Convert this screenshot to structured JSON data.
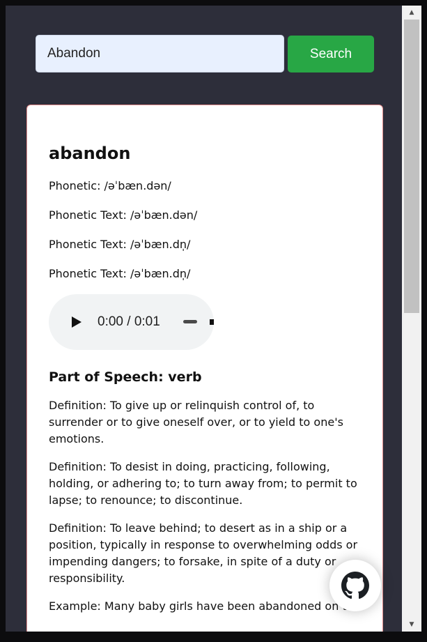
{
  "search": {
    "value": "Abandon",
    "button_label": "Search"
  },
  "entry": {
    "word": "abandon",
    "phonetics": [
      "Phonetic: /əˈbæn.dən/",
      "Phonetic Text: /əˈbæn.dən/",
      "Phonetic Text: /əˈbæn.dn̩/",
      "Phonetic Text: /əˈbæn.dn̩/"
    ],
    "audio": {
      "time": "0:00 / 0:01",
      "progress": 0
    },
    "part_of_speech": "Part of Speech: verb",
    "definitions": [
      "Definition: To give up or relinquish control of, to surrender or to give oneself over, or to yield to one's emotions.",
      "Definition: To desist in doing, practicing, following, holding, or adhering to; to turn away from; to permit to lapse; to renounce; to discontinue.",
      "Definition: To leave behind; to desert as in a ship or a position, typically in response to overwhelming odds or impending dangers; to forsake, in spite of a duty or responsibility.",
      "Example: Many baby girls have been abandoned on the"
    ]
  },
  "icons": {
    "play": "play-icon",
    "github": "github-icon",
    "scroll_up": "chevron-up-icon",
    "scroll_down": "chevron-down-icon"
  },
  "colors": {
    "background": "#2d2e3a",
    "search_button": "#28a745",
    "input_background": "#e8f0fe",
    "card_border": "#e38b8b"
  }
}
